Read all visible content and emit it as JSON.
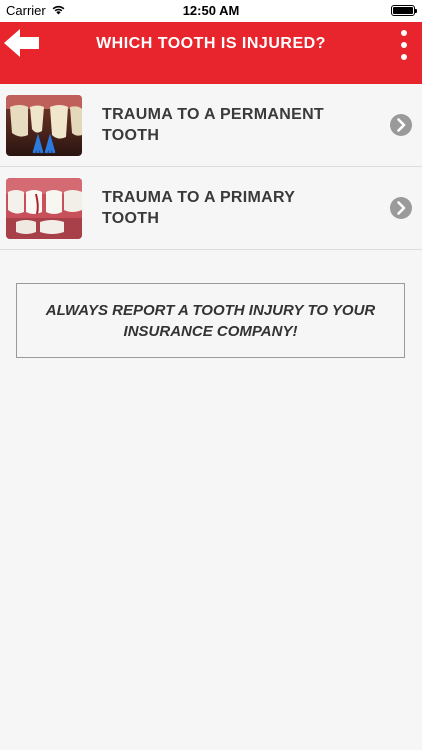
{
  "status_bar": {
    "carrier": "Carrier",
    "time": "12:50 AM"
  },
  "header": {
    "title": "WHICH TOOTH IS INJURED?",
    "back_icon": "arrow-left-icon",
    "menu_icon": "more-vertical-icon"
  },
  "list": {
    "items": [
      {
        "label": "TRAUMA TO A PERMANENT TOOTH",
        "icon": "chevron-right-icon"
      },
      {
        "label": "TRAUMA TO A PRIMARY TOOTH",
        "icon": "chevron-right-icon"
      }
    ]
  },
  "notice": {
    "text": "ALWAYS REPORT A TOOTH INJURY TO YOUR INSURANCE COMPANY!"
  },
  "colors": {
    "brand_red": "#e8242c",
    "background": "#f6f6f6",
    "text": "#3a3a3a",
    "chevron": "#9a9a9a"
  }
}
